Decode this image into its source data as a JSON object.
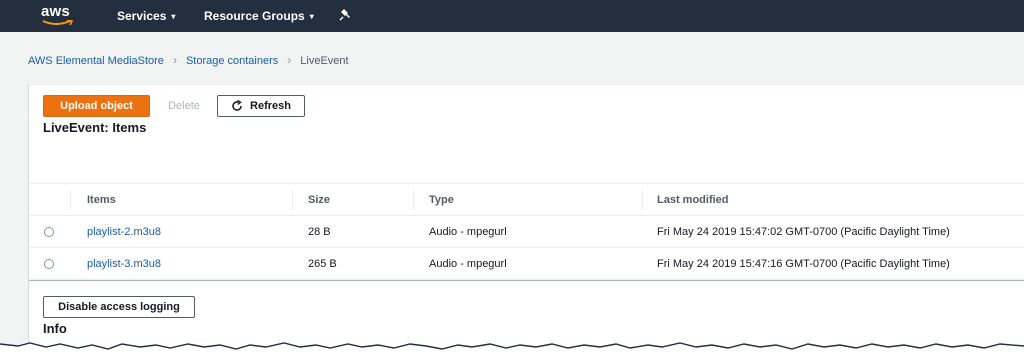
{
  "topnav": {
    "logo_text": "aws",
    "services_label": "Services",
    "resource_groups_label": "Resource Groups",
    "caret": "▾",
    "background_color": "#232f3e"
  },
  "breadcrumb": {
    "items": [
      "AWS Elemental MediaStore",
      "Storage containers",
      "LiveEvent"
    ],
    "separator": "›"
  },
  "toolbar": {
    "upload_label": "Upload object",
    "delete_label": "Delete",
    "refresh_label": "Refresh",
    "accent_color": "#ec7211"
  },
  "section_title": "LiveEvent: Items",
  "table": {
    "columns": [
      "Items",
      "Size",
      "Type",
      "Last modified"
    ],
    "rows": [
      {
        "name": "playlist-2.m3u8",
        "size": "28 B",
        "type": "Audio - mpegurl",
        "modified": "Fri May 24 2019 15:47:02 GMT-0700 (Pacific Daylight Time)"
      },
      {
        "name": "playlist-3.m3u8",
        "size": "265 B",
        "type": "Audio - mpegurl",
        "modified": "Fri May 24 2019 15:47:16 GMT-0700 (Pacific Daylight Time)"
      }
    ]
  },
  "access_logging": {
    "button_label": "Disable access logging"
  },
  "info_title": "Info",
  "icons": {
    "pin": "pin-icon",
    "refresh": "refresh-icon",
    "logo_smile": "aws-smile-icon"
  }
}
